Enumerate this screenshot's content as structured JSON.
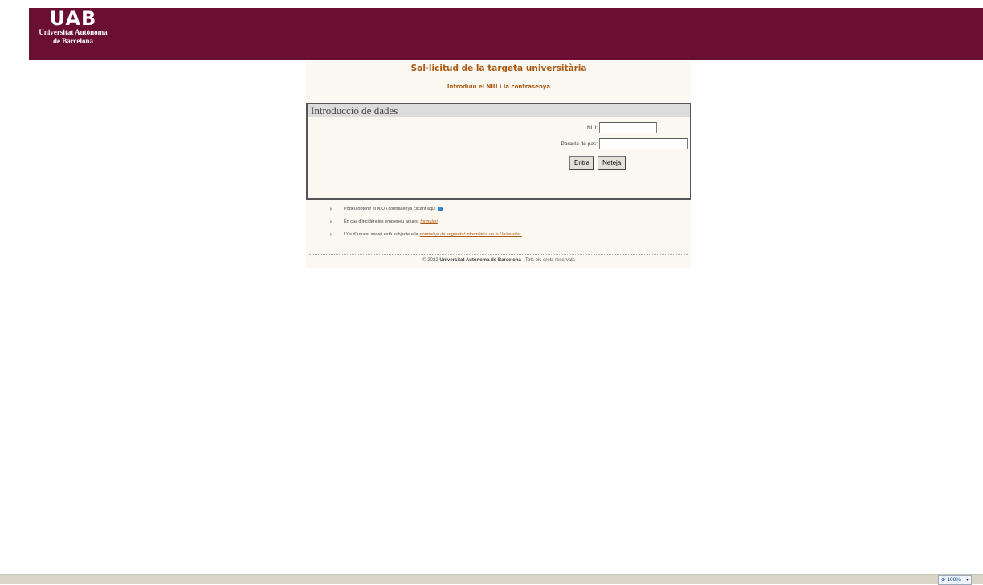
{
  "header": {
    "logo_mark": "UAB",
    "logo_line1": "Universitat Autònoma",
    "logo_line2": "de Barcelona"
  },
  "page": {
    "title": "Sol·licitud de la targeta universitària",
    "subtitle": "Introduïu el NIU i la contrasenya"
  },
  "form": {
    "section_title": "Introducció de dades",
    "niu_label": "NIU:",
    "niu_value": "",
    "password_label": "Paraula de pas:",
    "password_value": "",
    "submit_label": "Entra",
    "reset_label": "Neteja"
  },
  "links": {
    "item1_text": "Podeu obtenir el NIU i contrasenya clicant aquí",
    "item2_text": "En cas d'incidències empleneu aquest",
    "item2_link": "formulari",
    "item3_text": "L'ús d'aquest servei està subjecte a la",
    "item3_link": "normativa de seguretat informàtica de la Universitat."
  },
  "footer": {
    "prefix": "© 2022",
    "org": "Universitat Autònoma de Barcelona",
    "suffix": "- Tots els drets reservats"
  },
  "statusbar": {
    "zoom": "100%"
  },
  "colors": {
    "brand": "#6b0f32",
    "accent": "#a85a14",
    "link": "#b05a10"
  },
  "icons": {
    "bullet": "triangle-right-icon",
    "globe": "globe-icon",
    "zoom": "zoom-icon"
  }
}
